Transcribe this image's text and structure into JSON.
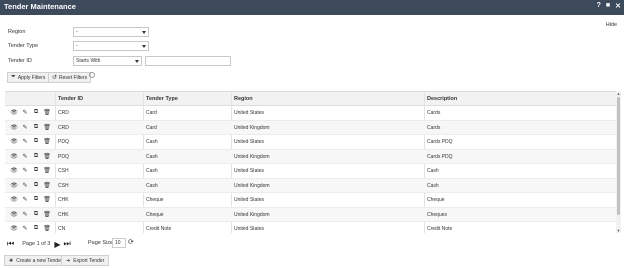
{
  "window": {
    "title": "Tender Maintenance",
    "help_glyph": "?",
    "max_glyph": "■",
    "close_glyph": "✕"
  },
  "filters": {
    "hide_label": "Hide",
    "region_label": "Region",
    "region_value": "-",
    "tender_type_label": "Tender Type",
    "tender_type_value": "-",
    "tender_id_label": "Tender ID",
    "tender_id_operator": "Starts With",
    "tender_id_value": "",
    "apply_label": "Apply Filters",
    "reset_label": "Reset Filters"
  },
  "grid": {
    "columns": [
      "Tender ID",
      "Tender Type",
      "Region",
      "Description"
    ],
    "rows": [
      [
        "CRD",
        "Card",
        "United States",
        "Cards"
      ],
      [
        "CRD",
        "Card",
        "United Kingdom",
        "Cards"
      ],
      [
        "PDQ",
        "Cash",
        "United States",
        "Cards PDQ"
      ],
      [
        "PDQ",
        "Cash",
        "United Kingdom",
        "Cards PDQ"
      ],
      [
        "CSH",
        "Cash",
        "United States",
        "Cash"
      ],
      [
        "CSH",
        "Cash",
        "United Kingdom",
        "Cash"
      ],
      [
        "CHK",
        "Cheque",
        "United States",
        "Cheque"
      ],
      [
        "CHK",
        "Cheque",
        "United Kingdom",
        "Cheques"
      ],
      [
        "CN",
        "Credit Note",
        "United States",
        "Credit Note"
      ]
    ]
  },
  "pager": {
    "page_text": "Page 1 of 3",
    "page_size_label": "Page Size",
    "page_size_value": "10"
  },
  "actions": {
    "create_label": "Create a new Tender",
    "export_label": "Export Tender"
  }
}
